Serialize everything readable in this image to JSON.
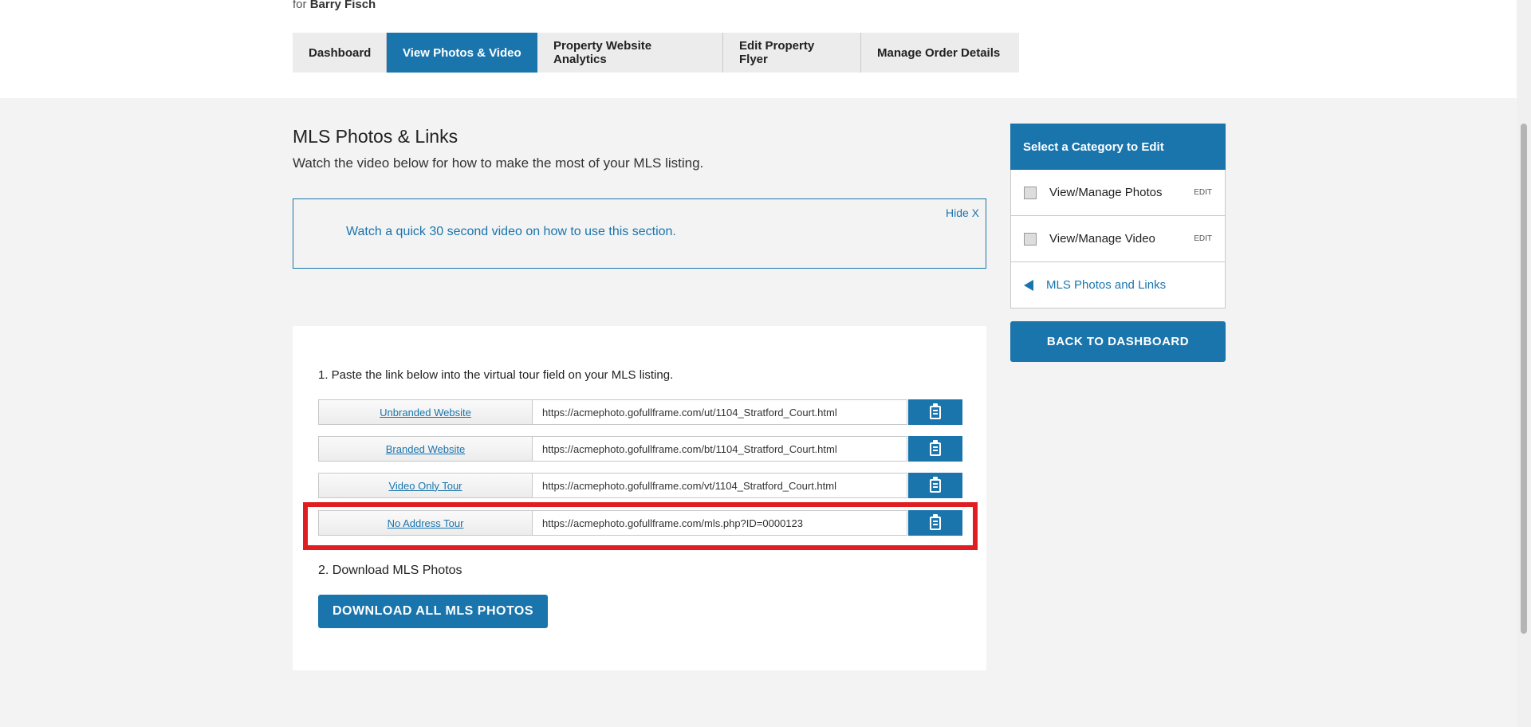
{
  "header": {
    "owner_prefix": "for",
    "owner_name": "Barry Fisch"
  },
  "tabs": [
    {
      "label": "Dashboard"
    },
    {
      "label": "View Photos & Video"
    },
    {
      "label": "Property Website Analytics"
    },
    {
      "label": "Edit Property Flyer"
    },
    {
      "label": "Manage Order Details"
    }
  ],
  "main": {
    "title": "MLS Photos & Links",
    "subtitle": "Watch the video below for how to make the most of your MLS listing.",
    "video_link": "Watch a quick 30 second video on how to use this section.",
    "hide_label": "Hide X",
    "step1": "1. Paste the link below into the virtual tour field on your MLS listing.",
    "links": [
      {
        "label": "Unbranded Website",
        "url": "https://acmephoto.gofullframe.com/ut/1104_Stratford_Court.html"
      },
      {
        "label": "Branded Website",
        "url": "https://acmephoto.gofullframe.com/bt/1104_Stratford_Court.html"
      },
      {
        "label": "Video Only Tour",
        "url": "https://acmephoto.gofullframe.com/vt/1104_Stratford_Court.html"
      },
      {
        "label": "No Address Tour",
        "url": "https://acmephoto.gofullframe.com/mls.php?ID=0000123"
      }
    ],
    "step2": "2. Download MLS Photos",
    "download_button": "DOWNLOAD ALL MLS PHOTOS"
  },
  "sidebar": {
    "heading": "Select a Category to Edit",
    "items": [
      {
        "label": "View/Manage Photos",
        "edit": "EDIT"
      },
      {
        "label": "View/Manage Video",
        "edit": "EDIT"
      }
    ],
    "active_link": "MLS Photos and Links",
    "back_button": "BACK TO DASHBOARD"
  },
  "colors": {
    "accent": "#1a75ad",
    "highlight": "#e01e22",
    "page_bg": "#f3f3f3"
  }
}
